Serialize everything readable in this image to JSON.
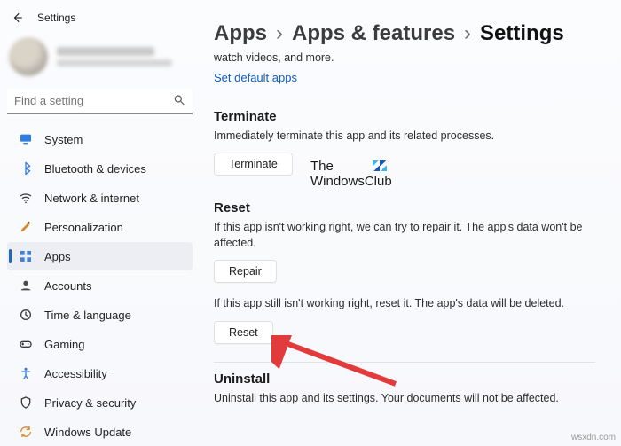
{
  "window": {
    "title": "Settings"
  },
  "search": {
    "placeholder": "Find a setting"
  },
  "nav": {
    "items": [
      {
        "key": "system",
        "label": "System"
      },
      {
        "key": "bluetooth",
        "label": "Bluetooth & devices"
      },
      {
        "key": "network",
        "label": "Network & internet"
      },
      {
        "key": "personalization",
        "label": "Personalization"
      },
      {
        "key": "apps",
        "label": "Apps"
      },
      {
        "key": "accounts",
        "label": "Accounts"
      },
      {
        "key": "time",
        "label": "Time & language"
      },
      {
        "key": "gaming",
        "label": "Gaming"
      },
      {
        "key": "accessibility",
        "label": "Accessibility"
      },
      {
        "key": "privacy",
        "label": "Privacy & security"
      },
      {
        "key": "update",
        "label": "Windows Update"
      }
    ],
    "active_key": "apps"
  },
  "breadcrumb": {
    "level1": "Apps",
    "level2": "Apps & features",
    "current": "Settings"
  },
  "intro": {
    "desc": "watch videos, and more.",
    "link": "Set default apps"
  },
  "terminate": {
    "heading": "Terminate",
    "desc": "Immediately terminate this app and its related processes.",
    "button": "Terminate"
  },
  "reset": {
    "heading": "Reset",
    "desc1": "If this app isn't working right, we can try to repair it. The app's data won't be affected.",
    "repair_button": "Repair",
    "desc2": "If this app still isn't working right, reset it. The app's data will be deleted.",
    "reset_button": "Reset"
  },
  "uninstall": {
    "heading": "Uninstall",
    "desc": "Uninstall this app and its settings. Your documents will not be affected."
  },
  "watermark": {
    "line1": "The",
    "line2": "WindowsClub"
  },
  "source_note": "wsxdn.com",
  "colors": {
    "accent_link": "#0f5bc0",
    "nav_active_bar": "#1868c4",
    "arrow": "#e23b3b"
  }
}
